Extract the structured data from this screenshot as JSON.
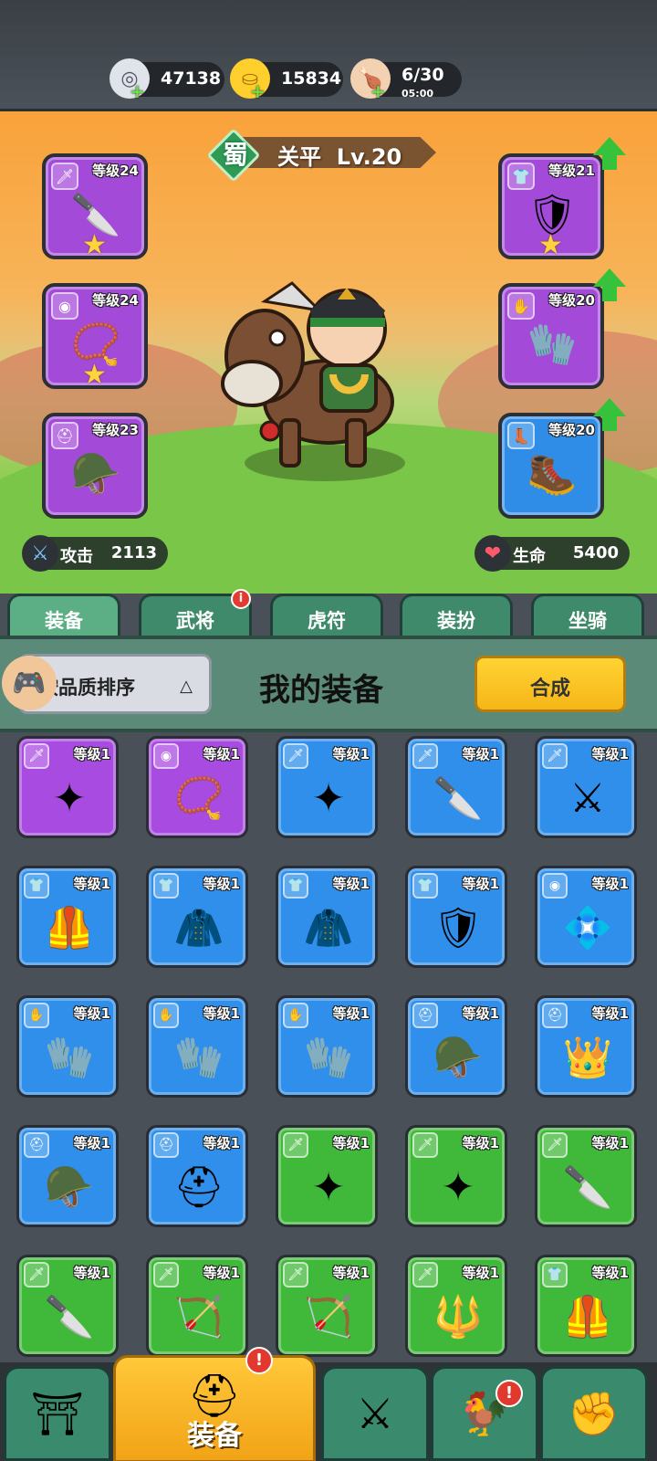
{
  "resources": [
    {
      "icon": "silver-coin-icon",
      "glyph": "◎",
      "value": "47138"
    },
    {
      "icon": "gold-ingot-icon",
      "glyph": "⛀",
      "value": "15834"
    },
    {
      "icon": "meat-stamina-icon",
      "glyph": "🍗",
      "value": "6/30",
      "timer": "05:00"
    }
  ],
  "hero": {
    "kingdom": "蜀",
    "name": "关平",
    "level": "Lv.20",
    "attack_label": "攻击",
    "attack_value": "2113",
    "hp_label": "生命",
    "hp_value": "5400"
  },
  "equipped": [
    {
      "slot": "weapon",
      "tag": "🗡",
      "item": "🔪",
      "level": "等级24",
      "quality": "purple",
      "star": true,
      "upgrade": false
    },
    {
      "slot": "amulet",
      "tag": "◉",
      "item": "📿",
      "level": "等级24",
      "quality": "purple",
      "star": true,
      "upgrade": false
    },
    {
      "slot": "helmet",
      "tag": "⛑",
      "item": "🪖",
      "level": "等级23",
      "quality": "purple",
      "star": false,
      "upgrade": false
    },
    {
      "slot": "armor",
      "tag": "👕",
      "item": "🛡",
      "level": "等级21",
      "quality": "purple",
      "star": true,
      "upgrade": true
    },
    {
      "slot": "gloves",
      "tag": "✋",
      "item": "🧤",
      "level": "等级20",
      "quality": "purple",
      "star": false,
      "upgrade": true
    },
    {
      "slot": "boots",
      "tag": "👢",
      "item": "🥾",
      "level": "等级20",
      "quality": "blue",
      "star": false,
      "upgrade": true
    }
  ],
  "tabs": [
    {
      "label": "装备",
      "active": true,
      "badge": false
    },
    {
      "label": "武将",
      "active": false,
      "badge": true
    },
    {
      "label": "虎符",
      "active": false,
      "badge": false
    },
    {
      "label": "装扮",
      "active": false,
      "badge": false
    },
    {
      "label": "坐骑",
      "active": false,
      "badge": false
    }
  ],
  "panel": {
    "sort_label": "按品质排序",
    "title": "我的装备",
    "synth_label": "合成"
  },
  "inventory": [
    {
      "quality": "purple",
      "tag": "🗡",
      "item": "✦",
      "level": "等级1"
    },
    {
      "quality": "purple",
      "tag": "◉",
      "item": "📿",
      "level": "等级1"
    },
    {
      "quality": "blue",
      "tag": "🗡",
      "item": "✦",
      "level": "等级1"
    },
    {
      "quality": "blue",
      "tag": "🗡",
      "item": "🔪",
      "level": "等级1"
    },
    {
      "quality": "blue",
      "tag": "🗡",
      "item": "⚔",
      "level": "等级1"
    },
    {
      "quality": "blue",
      "tag": "👕",
      "item": "🦺",
      "level": "等级1"
    },
    {
      "quality": "blue",
      "tag": "👕",
      "item": "🧥",
      "level": "等级1"
    },
    {
      "quality": "blue",
      "tag": "👕",
      "item": "🧥",
      "level": "等级1"
    },
    {
      "quality": "blue",
      "tag": "👕",
      "item": "🛡",
      "level": "等级1"
    },
    {
      "quality": "blue",
      "tag": "◉",
      "item": "💠",
      "level": "等级1"
    },
    {
      "quality": "blue",
      "tag": "✋",
      "item": "🧤",
      "level": "等级1"
    },
    {
      "quality": "blue",
      "tag": "✋",
      "item": "🧤",
      "level": "等级1"
    },
    {
      "quality": "blue",
      "tag": "✋",
      "item": "🧤",
      "level": "等级1"
    },
    {
      "quality": "blue",
      "tag": "⛑",
      "item": "🪖",
      "level": "等级1"
    },
    {
      "quality": "blue",
      "tag": "⛑",
      "item": "👑",
      "level": "等级1"
    },
    {
      "quality": "blue",
      "tag": "⛑",
      "item": "🪖",
      "level": "等级1"
    },
    {
      "quality": "blue",
      "tag": "⛑",
      "item": "⛑",
      "level": "等级1"
    },
    {
      "quality": "green",
      "tag": "🗡",
      "item": "✦",
      "level": "等级1"
    },
    {
      "quality": "green",
      "tag": "🗡",
      "item": "✦",
      "level": "等级1"
    },
    {
      "quality": "green",
      "tag": "🗡",
      "item": "🔪",
      "level": "等级1"
    },
    {
      "quality": "green",
      "tag": "🗡",
      "item": "🔪",
      "level": "等级1"
    },
    {
      "quality": "green",
      "tag": "🗡",
      "item": "🏹",
      "level": "等级1"
    },
    {
      "quality": "green",
      "tag": "🗡",
      "item": "🏹",
      "level": "等级1"
    },
    {
      "quality": "green",
      "tag": "🗡",
      "item": "🔱",
      "level": "等级1"
    },
    {
      "quality": "green",
      "tag": "👕",
      "item": "🦺",
      "level": "等级1"
    }
  ],
  "bottom_nav": [
    {
      "icon": "city-gate-icon",
      "glyph": "⛩",
      "label": "",
      "active": false,
      "alert": false
    },
    {
      "icon": "helmet-icon",
      "glyph": "⛑",
      "label": "装备",
      "active": true,
      "alert": true
    },
    {
      "icon": "crossed-swords-icon",
      "glyph": "⚔",
      "label": "",
      "active": false,
      "alert": false
    },
    {
      "icon": "rooster-stars-icon",
      "glyph": "🐓",
      "label": "",
      "active": false,
      "alert": true
    },
    {
      "icon": "fist-upgrade-icon",
      "glyph": "✊",
      "label": "",
      "active": false,
      "alert": false
    }
  ],
  "alert_glyph": "!",
  "colors": {
    "purple": "#a84be0",
    "blue": "#2f8fea",
    "green": "#40b83a",
    "tab": "#3f8a6a",
    "synth": "#f6b617"
  }
}
